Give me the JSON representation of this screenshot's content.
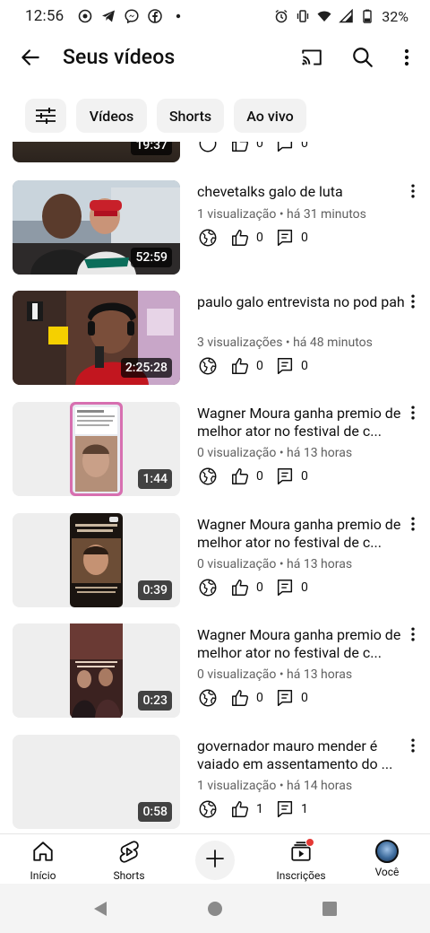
{
  "status_bar": {
    "time": "12:56",
    "battery": "32%",
    "left_icons": [
      "at-sign-icon",
      "telegram-icon",
      "messenger-icon",
      "facebook-icon",
      "dot-icon"
    ],
    "right_icons": [
      "alarm-icon",
      "vibrate-icon",
      "wifi-icon",
      "signal-icon",
      "battery-icon"
    ]
  },
  "header": {
    "title": "Seus vídeos",
    "icons": [
      "back-arrow-icon",
      "cast-icon",
      "search-icon",
      "more-vertical-icon"
    ]
  },
  "filters": {
    "items": [
      "Vídeos",
      "Shorts",
      "Ao vivo"
    ]
  },
  "videos": [
    {
      "title": "",
      "meta": "",
      "duration": "19:37",
      "likes": "0",
      "comments": "0"
    },
    {
      "title": "chevetalks galo de luta",
      "meta": "1 visualização • há 31 minutos",
      "duration": "52:59",
      "likes": "0",
      "comments": "0"
    },
    {
      "title": "paulo galo entrevista no pod pah",
      "meta": "3 visualizações • há 48 minutos",
      "duration": "2:25:28",
      "likes": "0",
      "comments": "0"
    },
    {
      "title": "Wagner Moura ganha premio de melhor ator no festival de c...",
      "meta": "0 visualização • há 13 horas",
      "duration": "1:44",
      "likes": "0",
      "comments": "0"
    },
    {
      "title": "Wagner Moura ganha premio de melhor ator no festival de c...",
      "meta": "0 visualização • há 13 horas",
      "duration": "0:39",
      "likes": "0",
      "comments": "0"
    },
    {
      "title": "Wagner Moura ganha premio de melhor ator no festival de c...",
      "meta": "0 visualização • há 13 horas",
      "duration": "0:23",
      "likes": "0",
      "comments": "0"
    },
    {
      "title": "governador mauro mender é vaiado em assentamento do ...",
      "meta": "1 visualização • há 14 horas",
      "duration": "0:58",
      "likes": "1",
      "comments": "1"
    }
  ],
  "bottom_nav": {
    "items": [
      {
        "label": "Início",
        "icon": "home-icon"
      },
      {
        "label": "Shorts",
        "icon": "shorts-icon"
      },
      {
        "label": "",
        "icon": "create-plus-icon"
      },
      {
        "label": "Inscrições",
        "icon": "subscriptions-icon"
      },
      {
        "label": "Você",
        "icon": "avatar"
      }
    ]
  },
  "colors": {
    "accent": "#0f0f0f",
    "meta_text": "#606060",
    "chip_bg": "#f2f2f2",
    "notification": "#e53935"
  }
}
